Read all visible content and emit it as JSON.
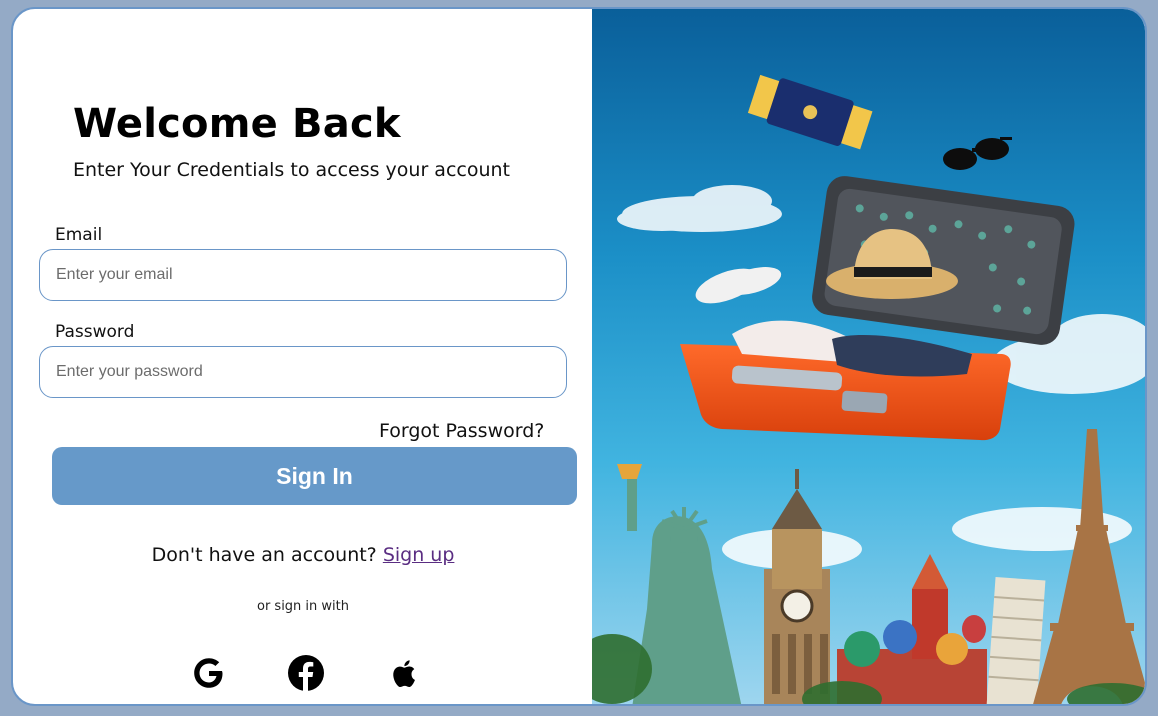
{
  "login": {
    "title": "Welcome Back",
    "subtitle": "Enter Your Credentials to access your account",
    "email_label": "Email",
    "email_placeholder": "Enter your email",
    "email_value": "",
    "password_label": "Password",
    "password_placeholder": "Enter your password",
    "password_value": "",
    "forgot_label": "Forgot Password?",
    "signin_label": "Sign In",
    "signup_prompt": "Don't have an account?",
    "signup_link": "Sign up",
    "or_text": "or sign in with"
  },
  "social": {
    "google_icon": "google-icon",
    "facebook_icon": "facebook-icon",
    "apple_icon": "apple-icon"
  },
  "hero": {
    "description_icon": "travel-suitcase-landmarks-illustration"
  },
  "colors": {
    "accent": "#6699c9",
    "border": "#6a96c8",
    "link": "#5a2d82",
    "page_background": "#94aac6"
  }
}
